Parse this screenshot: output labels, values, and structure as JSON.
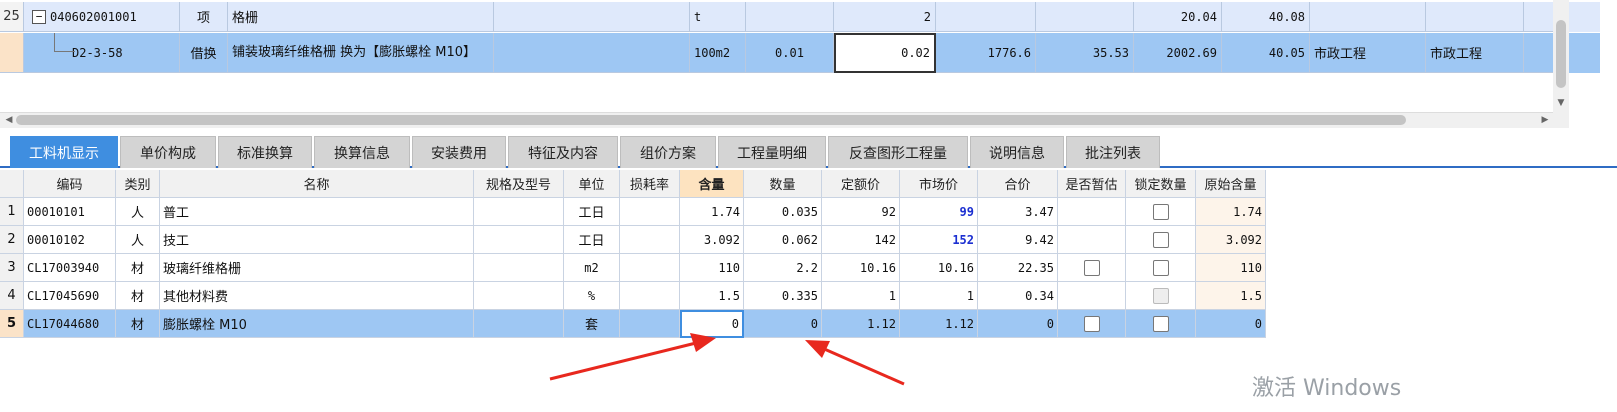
{
  "top_grid": {
    "rows": [
      {
        "index": "25",
        "code": "040602001001",
        "type": "项",
        "name": "格栅",
        "unit": "t",
        "qty_a": "",
        "qty": "2",
        "price": "",
        "c1": "",
        "c2": "20.04",
        "c3": "40.08",
        "major": "",
        "major2": ""
      },
      {
        "index": "",
        "code": "D2-3-58",
        "type": "借换",
        "name": "铺装玻璃纤维格栅  换为【膨胀螺栓 M10】",
        "unit": "100m2",
        "qty_a": "0.01",
        "qty": "0.02",
        "price": "1776.6",
        "c1": "35.53",
        "c2": "2002.69",
        "c3": "40.05",
        "major": "市政工程",
        "major2": "市政工程"
      }
    ]
  },
  "tabs": [
    "工料机显示",
    "单价构成",
    "标准换算",
    "换算信息",
    "安装费用",
    "特征及内容",
    "组价方案",
    "工程量明细",
    "反查图形工程量",
    "说明信息",
    "批注列表"
  ],
  "active_tab": "工料机显示",
  "detail_grid": {
    "headers": [
      "编码",
      "类别",
      "名称",
      "规格及型号",
      "单位",
      "损耗率",
      "含量",
      "数量",
      "定额价",
      "市场价",
      "合价",
      "是否暂估",
      "锁定数量",
      "原始含量"
    ],
    "rows": [
      {
        "index": "1",
        "code": "00010101",
        "cat": "人",
        "name": "普工",
        "spec": "",
        "unit": "工日",
        "loss": "",
        "content": "1.74",
        "qty": "0.035",
        "quota": "92",
        "market": "99",
        "total": "3.47",
        "orig": "1.74"
      },
      {
        "index": "2",
        "code": "00010102",
        "cat": "人",
        "name": "技工",
        "spec": "",
        "unit": "工日",
        "loss": "",
        "content": "3.092",
        "qty": "0.062",
        "quota": "142",
        "market": "152",
        "total": "9.42",
        "orig": "3.092"
      },
      {
        "index": "3",
        "code": "CL17003940",
        "cat": "材",
        "name": "玻璃纤维格栅",
        "spec": "",
        "unit": "m2",
        "loss": "",
        "content": "110",
        "qty": "2.2",
        "quota": "10.16",
        "market": "10.16",
        "total": "22.35",
        "orig": "110"
      },
      {
        "index": "4",
        "code": "CL17045690",
        "cat": "材",
        "name": "其他材料费",
        "spec": "",
        "unit": "%",
        "loss": "",
        "content": "1.5",
        "qty": "0.335",
        "quota": "1",
        "market": "1",
        "total": "0.34",
        "orig": "1.5"
      },
      {
        "index": "5",
        "code": "CL17044680",
        "cat": "材",
        "name": "膨胀螺栓 M10",
        "spec": "",
        "unit": "套",
        "loss": "",
        "content": "0",
        "qty": "0",
        "quota": "1.12",
        "market": "1.12",
        "total": "0",
        "orig": "0"
      }
    ]
  },
  "watermark": "激活 Windows",
  "colors": {
    "selected_row": "#9ec7f3",
    "active_tab": "#3f8ee0",
    "highlight_header": "#fde3c0",
    "arrow": "#e8281e"
  }
}
